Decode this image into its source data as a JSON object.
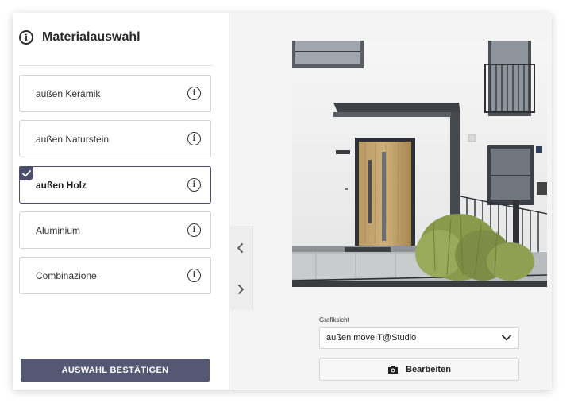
{
  "panel": {
    "title": "Materialauswahl",
    "info_icon": "info-icon"
  },
  "options": [
    {
      "label": "außen Keramik",
      "selected": false
    },
    {
      "label": "außen Naturstein",
      "selected": false
    },
    {
      "label": "außen Holz",
      "selected": true
    },
    {
      "label": "Aluminium",
      "selected": false
    },
    {
      "label": "Combinazione",
      "selected": false
    }
  ],
  "confirm_button": "AUSWAHL BESTÄTIGEN",
  "nav": {
    "prev_icon": "chevron-left-icon",
    "next_icon": "chevron-right-icon"
  },
  "view": {
    "label": "Grafiksicht",
    "selected_value": "außen moveIT@Studio",
    "edit_label": "Bearbeiten",
    "edit_icon": "camera-icon"
  },
  "colors": {
    "accent": "#545873",
    "selected_border": "#4a4e6b"
  }
}
